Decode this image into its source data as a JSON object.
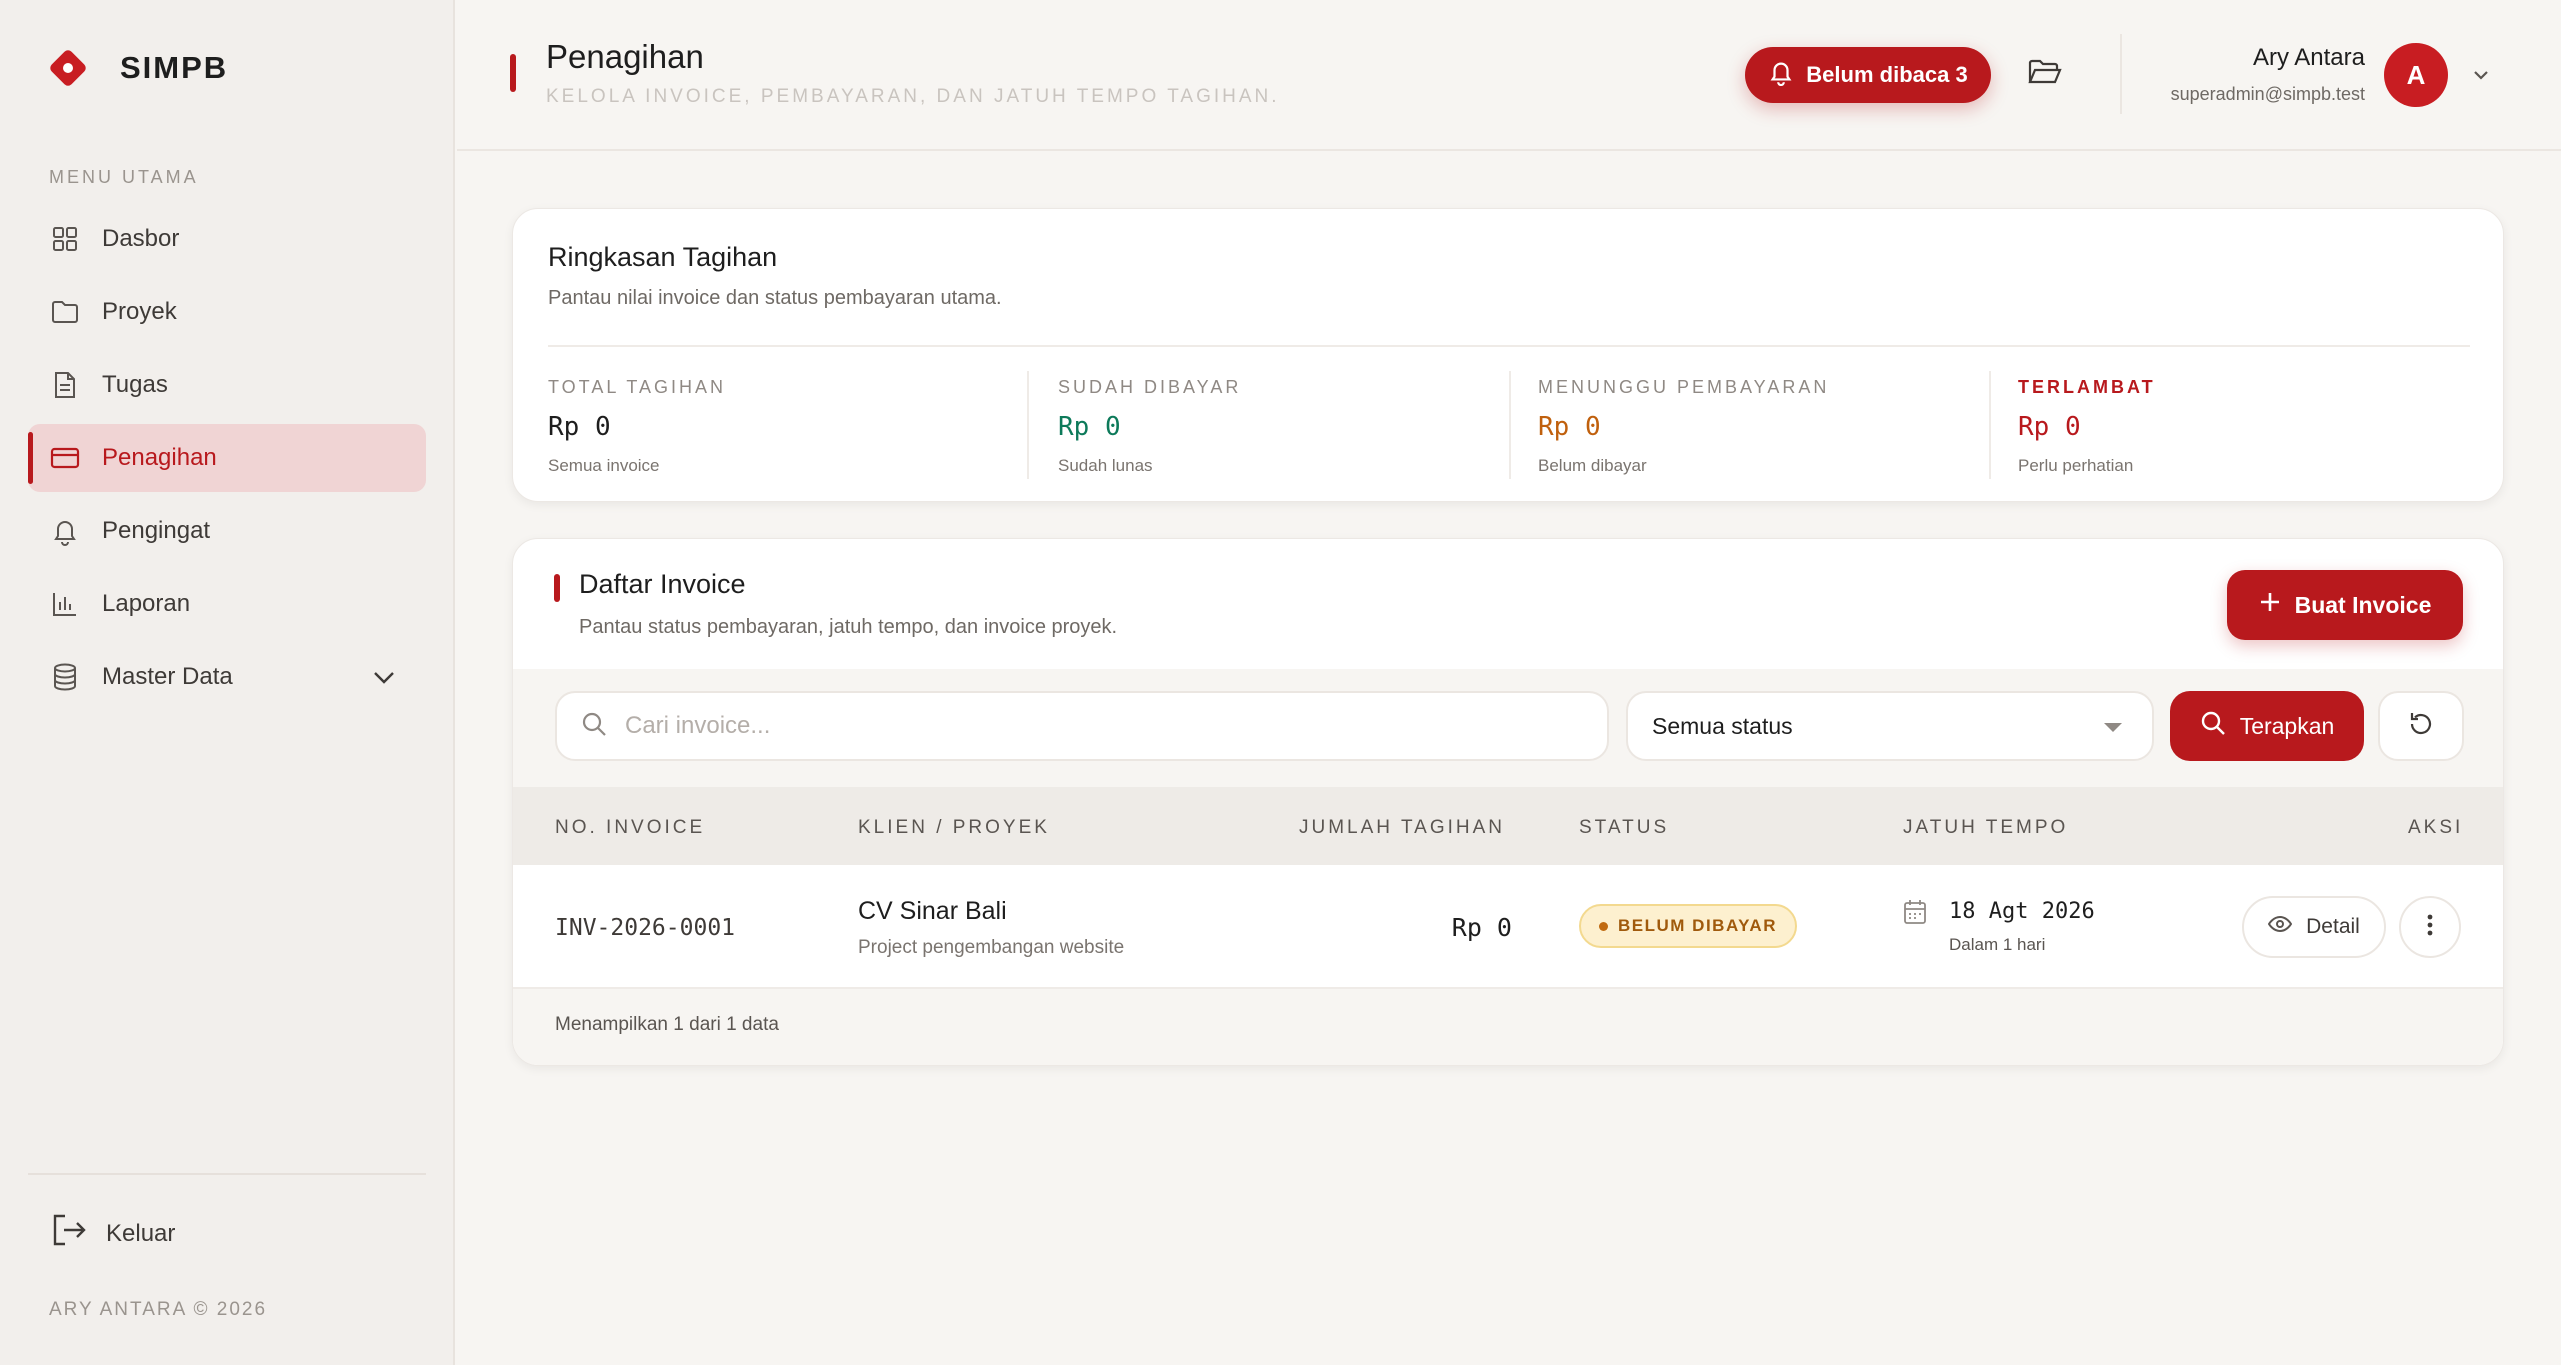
{
  "app": {
    "name": "SIMPB",
    "footer": "ARY ANTARA © 2026"
  },
  "colors": {
    "accent": "#b8191d",
    "paid": "#0d7a5a",
    "pending": "#c0600d",
    "overdue": "#b8191d"
  },
  "sidebar": {
    "heading": "MENU UTAMA",
    "items": [
      {
        "label": "Dasbor",
        "icon": "grid-icon"
      },
      {
        "label": "Proyek",
        "icon": "folder-icon"
      },
      {
        "label": "Tugas",
        "icon": "document-icon"
      },
      {
        "label": "Penagihan",
        "icon": "credit-card-icon",
        "active": true
      },
      {
        "label": "Pengingat",
        "icon": "bell-icon"
      },
      {
        "label": "Laporan",
        "icon": "bar-chart-icon"
      },
      {
        "label": "Master Data",
        "icon": "database-icon",
        "expandable": true
      }
    ],
    "logout_label": "Keluar"
  },
  "header": {
    "title": "Penagihan",
    "subtitle": "KELOLA INVOICE, PEMBAYARAN, DAN JATUH TEMPO TAGIHAN.",
    "notif_label": "Belum dibaca 3",
    "user": {
      "name": "Ary Antara",
      "email": "superadmin@simpb.test",
      "initial": "A"
    }
  },
  "summary": {
    "title": "Ringkasan Tagihan",
    "subtitle": "Pantau nilai invoice dan status pembayaran utama.",
    "stats": [
      {
        "label": "TOTAL TAGIHAN",
        "value": "Rp 0",
        "note": "Semua invoice"
      },
      {
        "label": "SUDAH DIBAYAR",
        "value": "Rp 0",
        "note": "Sudah lunas"
      },
      {
        "label": "MENUNGGU PEMBAYARAN",
        "value": "Rp 0",
        "note": "Belum dibayar"
      },
      {
        "label": "TERLAMBAT",
        "value": "Rp 0",
        "note": "Perlu perhatian"
      }
    ]
  },
  "invoices": {
    "title": "Daftar Invoice",
    "subtitle": "Pantau status pembayaran, jatuh tempo, dan invoice proyek.",
    "create_label": "Buat Invoice",
    "search_placeholder": "Cari invoice...",
    "search_value": "",
    "status_selected": "Semua status",
    "apply_label": "Terapkan",
    "columns": [
      "NO. INVOICE",
      "KLIEN / PROYEK",
      "JUMLAH TAGIHAN",
      "STATUS",
      "JATUH TEMPO",
      "AKSI"
    ],
    "rows": [
      {
        "number": "INV-2026-0001",
        "client": "CV Sinar Bali",
        "project": "Project pengembangan website",
        "amount": "Rp 0",
        "status": "BELUM DIBAYAR",
        "due_date": "18 Agt 2026",
        "due_note": "Dalam 1 hari",
        "detail_label": "Detail"
      }
    ],
    "footer": "Menampilkan 1 dari 1 data"
  }
}
